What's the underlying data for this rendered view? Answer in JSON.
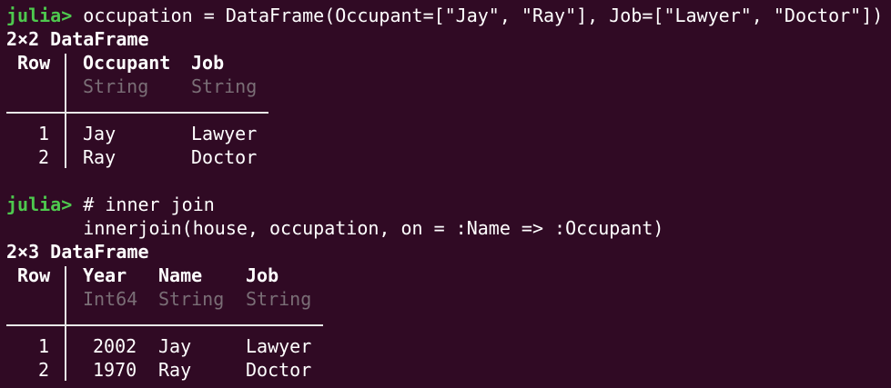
{
  "prompt": "julia>",
  "commands": {
    "first": " occupation = DataFrame(Occupant=[\"Jay\", \"Ray\"], Job=[\"Lawyer\", \"Doctor\"])",
    "comment": " # inner join",
    "join": "       innerjoin(house, occupation, on = :Name => :Occupant)"
  },
  "table1": {
    "summary": "2×2 DataFrame",
    "row_header": "Row",
    "columns": [
      {
        "name": "Occupant",
        "type": "String"
      },
      {
        "name": "Job",
        "type": "String"
      }
    ],
    "rows": [
      {
        "index": "1",
        "cells": [
          "Jay",
          "Lawyer"
        ]
      },
      {
        "index": "2",
        "cells": [
          "Ray",
          "Doctor"
        ]
      }
    ]
  },
  "table2": {
    "summary": "2×3 DataFrame",
    "row_header": "Row",
    "columns": [
      {
        "name": "Year",
        "type": "Int64"
      },
      {
        "name": "Name",
        "type": "String"
      },
      {
        "name": "Job",
        "type": "String"
      }
    ],
    "rows": [
      {
        "index": "1",
        "cells": [
          "2002",
          "Jay",
          "Lawyer"
        ]
      },
      {
        "index": "2",
        "cells": [
          "1970",
          "Ray",
          "Doctor"
        ]
      }
    ]
  },
  "colors": {
    "background": "#300a24",
    "prompt": "#4ec94e",
    "foreground": "#ffffff",
    "type_text": "#7a6e76"
  }
}
